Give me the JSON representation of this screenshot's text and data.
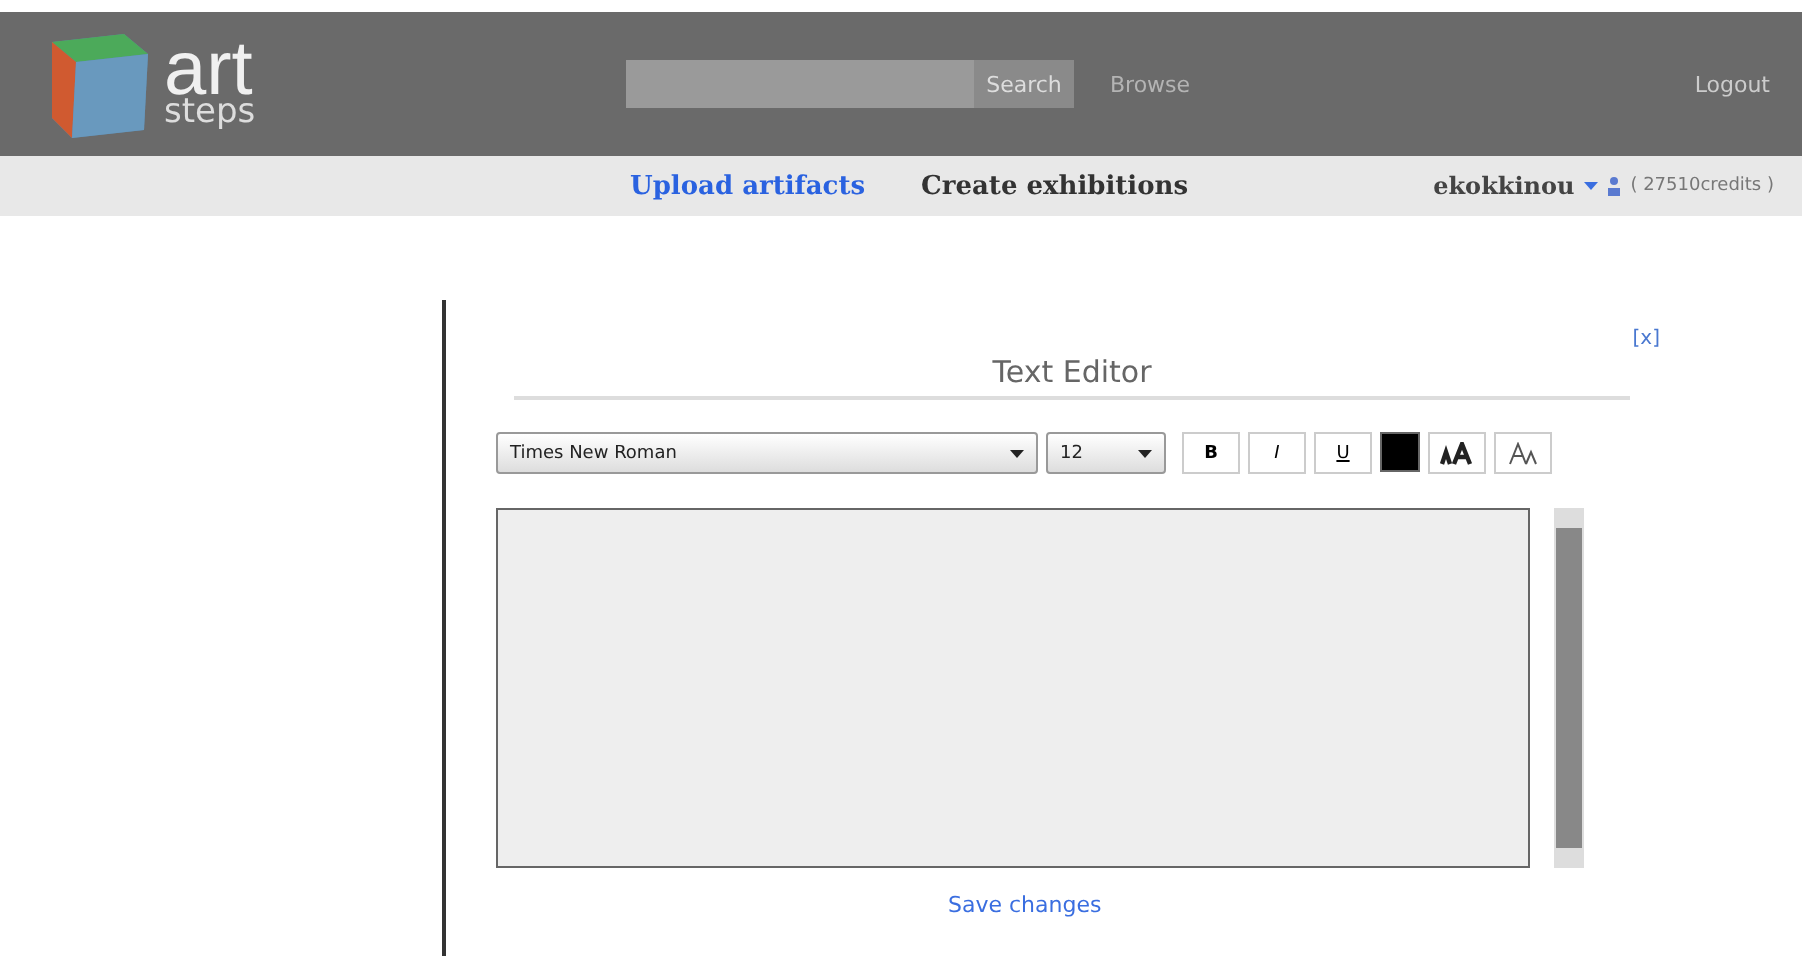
{
  "header": {
    "logo": {
      "word": "art",
      "subword": "steps"
    },
    "search": {
      "button": "Search"
    },
    "browse": "Browse",
    "logout": "Logout"
  },
  "nav": {
    "links": [
      {
        "label": "Upload artifacts",
        "selected": true
      },
      {
        "label": "Create exhibitions",
        "selected": false
      }
    ],
    "user": "ekokkinou",
    "credits": "( 27510credits )"
  },
  "editor": {
    "close": "[x]",
    "title": "Text Editor",
    "font": "Times New Roman",
    "size": "12",
    "tools": [
      {
        "kind": "text",
        "label": "B"
      },
      {
        "kind": "text",
        "label": "I"
      },
      {
        "kind": "text",
        "label": "U"
      },
      {
        "kind": "color",
        "color": "#000000"
      },
      {
        "kind": "grow"
      },
      {
        "kind": "shrink"
      }
    ],
    "save": "Save changes"
  }
}
